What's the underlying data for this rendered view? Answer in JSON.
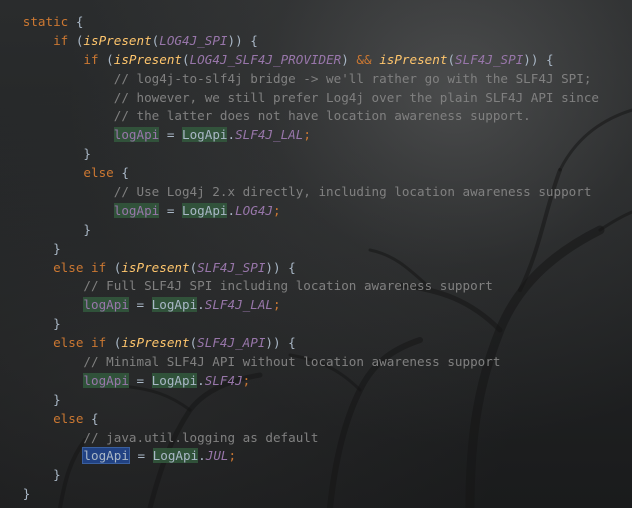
{
  "editor": {
    "language": "java",
    "lines": [
      {
        "indent": 1,
        "tokens": [
          {
            "t": "static",
            "c": "kw"
          },
          {
            "t": " {",
            "c": "cls"
          }
        ]
      },
      {
        "indent": 3,
        "tokens": [
          {
            "t": "if",
            "c": "kw"
          },
          {
            "t": " (",
            "c": "cls"
          },
          {
            "t": "isPresent",
            "c": "mcall"
          },
          {
            "t": "(",
            "c": "cls"
          },
          {
            "t": "LOG4J_SPI",
            "c": "sconst"
          },
          {
            "t": ")) {",
            "c": "cls"
          }
        ]
      },
      {
        "indent": 5,
        "tokens": [
          {
            "t": "if",
            "c": "kw"
          },
          {
            "t": " (",
            "c": "cls"
          },
          {
            "t": "isPresent",
            "c": "mcall"
          },
          {
            "t": "(",
            "c": "cls"
          },
          {
            "t": "LOG4J_SLF4J_PROVIDER",
            "c": "sconst"
          },
          {
            "t": ") ",
            "c": "cls"
          },
          {
            "t": "&&",
            "c": "op"
          },
          {
            "t": " ",
            "c": "cls"
          },
          {
            "t": "isPresent",
            "c": "mcall"
          },
          {
            "t": "(",
            "c": "cls"
          },
          {
            "t": "SLF4J_SPI",
            "c": "sconst"
          },
          {
            "t": ")) {",
            "c": "cls"
          }
        ]
      },
      {
        "indent": 7,
        "tokens": [
          {
            "t": "// log4j-to-slf4j bridge -> we'll rather go with the SLF4J SPI;",
            "c": "cmt"
          }
        ]
      },
      {
        "indent": 7,
        "tokens": [
          {
            "t": "// however, we still prefer Log4j over the plain SLF4J API since",
            "c": "cmt"
          }
        ]
      },
      {
        "indent": 7,
        "tokens": [
          {
            "t": "// the latter does not have location awareness support.",
            "c": "cmt"
          }
        ]
      },
      {
        "indent": 7,
        "tokens": [
          {
            "t": "logApi",
            "c": "ref-hl"
          },
          {
            "t": " = ",
            "c": "cls"
          },
          {
            "t": "LogApi",
            "c": "cls-hl"
          },
          {
            "t": ".",
            "c": "cls"
          },
          {
            "t": "SLF4J_LAL",
            "c": "sconst"
          },
          {
            "t": ";",
            "c": "kw"
          }
        ]
      },
      {
        "indent": 5,
        "tokens": [
          {
            "t": "}",
            "c": "cls"
          }
        ]
      },
      {
        "indent": 5,
        "tokens": [
          {
            "t": "else",
            "c": "kw"
          },
          {
            "t": " {",
            "c": "cls"
          }
        ]
      },
      {
        "indent": 7,
        "tokens": [
          {
            "t": "// Use Log4j 2.x directly, including location awareness support",
            "c": "cmt"
          }
        ]
      },
      {
        "indent": 7,
        "tokens": [
          {
            "t": "logApi",
            "c": "ref-hl"
          },
          {
            "t": " = ",
            "c": "cls"
          },
          {
            "t": "LogApi",
            "c": "cls-hl"
          },
          {
            "t": ".",
            "c": "cls"
          },
          {
            "t": "LOG4J",
            "c": "sconst"
          },
          {
            "t": ";",
            "c": "kw"
          }
        ]
      },
      {
        "indent": 5,
        "tokens": [
          {
            "t": "}",
            "c": "cls"
          }
        ]
      },
      {
        "indent": 3,
        "tokens": [
          {
            "t": "}",
            "c": "cls"
          }
        ]
      },
      {
        "indent": 3,
        "tokens": [
          {
            "t": "else if",
            "c": "kw"
          },
          {
            "t": " (",
            "c": "cls"
          },
          {
            "t": "isPresent",
            "c": "mcall"
          },
          {
            "t": "(",
            "c": "cls"
          },
          {
            "t": "SLF4J_SPI",
            "c": "sconst"
          },
          {
            "t": ")) {",
            "c": "cls"
          }
        ]
      },
      {
        "indent": 5,
        "tokens": [
          {
            "t": "// Full SLF4J SPI including location awareness support",
            "c": "cmt"
          }
        ]
      },
      {
        "indent": 5,
        "tokens": [
          {
            "t": "logApi",
            "c": "ref-hl"
          },
          {
            "t": " = ",
            "c": "cls"
          },
          {
            "t": "LogApi",
            "c": "cls-hl"
          },
          {
            "t": ".",
            "c": "cls"
          },
          {
            "t": "SLF4J_LAL",
            "c": "sconst"
          },
          {
            "t": ";",
            "c": "kw"
          }
        ]
      },
      {
        "indent": 3,
        "tokens": [
          {
            "t": "}",
            "c": "cls"
          }
        ]
      },
      {
        "indent": 3,
        "tokens": [
          {
            "t": "else if",
            "c": "kw"
          },
          {
            "t": " (",
            "c": "cls"
          },
          {
            "t": "isPresent",
            "c": "mcall"
          },
          {
            "t": "(",
            "c": "cls"
          },
          {
            "t": "SLF4J_API",
            "c": "sconst"
          },
          {
            "t": ")) {",
            "c": "cls"
          }
        ]
      },
      {
        "indent": 5,
        "tokens": [
          {
            "t": "// Minimal SLF4J API without location awareness support",
            "c": "cmt"
          }
        ]
      },
      {
        "indent": 5,
        "tokens": [
          {
            "t": "logApi",
            "c": "ref-hl"
          },
          {
            "t": " = ",
            "c": "cls"
          },
          {
            "t": "LogApi",
            "c": "cls-hl"
          },
          {
            "t": ".",
            "c": "cls"
          },
          {
            "t": "SLF4J",
            "c": "sconst"
          },
          {
            "t": ";",
            "c": "kw"
          }
        ]
      },
      {
        "indent": 3,
        "tokens": [
          {
            "t": "}",
            "c": "cls"
          }
        ]
      },
      {
        "indent": 3,
        "tokens": [
          {
            "t": "else",
            "c": "kw"
          },
          {
            "t": " {",
            "c": "cls"
          }
        ]
      },
      {
        "indent": 5,
        "tokens": [
          {
            "t": "// java.util.logging as default",
            "c": "cmt"
          }
        ]
      },
      {
        "indent": 5,
        "tokens": [
          {
            "t": "logApi",
            "c": "cur-hl"
          },
          {
            "t": " = ",
            "c": "cls"
          },
          {
            "t": "LogApi",
            "c": "cls-hl"
          },
          {
            "t": ".",
            "c": "cls"
          },
          {
            "t": "JUL",
            "c": "sconst"
          },
          {
            "t": ";",
            "c": "kw"
          }
        ]
      },
      {
        "indent": 3,
        "tokens": [
          {
            "t": "}",
            "c": "cls"
          }
        ]
      },
      {
        "indent": 1,
        "tokens": [
          {
            "t": "}",
            "c": "cls"
          }
        ]
      }
    ]
  },
  "theme": {
    "keyword": "#cc7832",
    "method": "#ffc66d",
    "static_field": "#9876aa",
    "comment": "#808080",
    "default_text": "#a9b7c6",
    "usage_highlight": "#32593d",
    "selection_highlight": "#214283"
  }
}
